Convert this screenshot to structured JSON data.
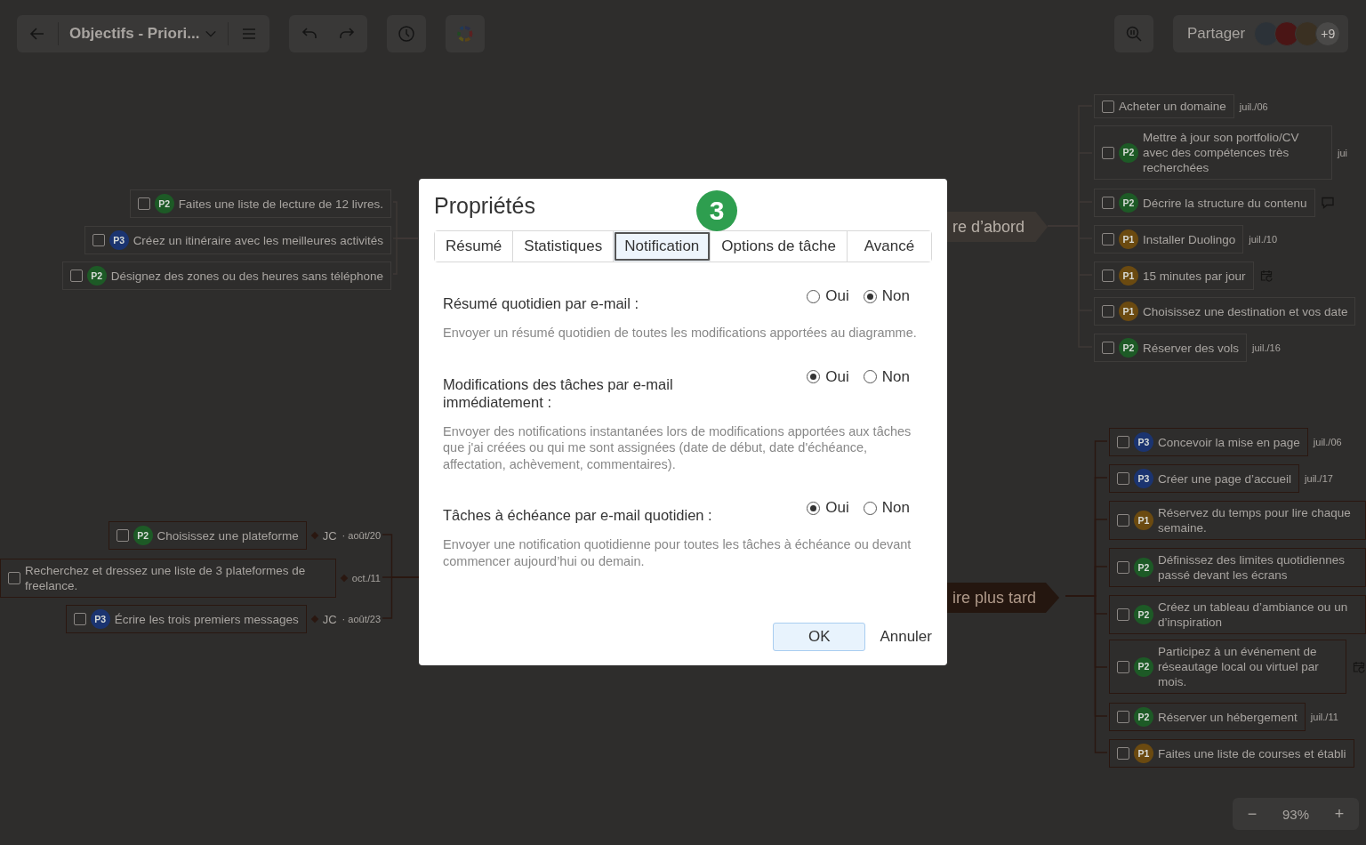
{
  "toolbar": {
    "title": "Objectifs - Priori...",
    "share_label": "Partager",
    "share_more": "+9"
  },
  "topics": [
    {
      "label": "re d’abord"
    },
    {
      "label": "ire plus tard"
    }
  ],
  "task_groups": [
    {
      "tasks": [
        {
          "text": "Faites une liste de lecture de 12 livres.",
          "priority": "P2",
          "color": "#1d5a26",
          "checked": false
        },
        {
          "text": "Créez un itinéraire avec les meilleures activités",
          "priority": "P3",
          "color": "#1b3470",
          "checked": false
        },
        {
          "text": "Désignez des zones ou des heures sans téléphone",
          "priority": "P2",
          "color": "#1d5a26",
          "checked": false
        }
      ]
    },
    {
      "tasks": [
        {
          "text": "Acheter un domaine",
          "checked": false,
          "date": "juil./06"
        },
        {
          "text": "Mettre à jour son portfolio/CV avec des compétences très recherchées",
          "priority": "P2",
          "color": "#1d5a26",
          "checked": false,
          "date": "jui"
        },
        {
          "text": "Décrire la structure du contenu",
          "priority": "P2",
          "color": "#1d5a26",
          "checked": false,
          "kind": "comment"
        },
        {
          "text": "Installer Duolingo",
          "priority": "P1",
          "color": "#6b4a10",
          "checked": false,
          "date": "juil./10"
        },
        {
          "text": "15 minutes par jour",
          "priority": "P1",
          "color": "#6b4a10",
          "checked": false,
          "kind": "recurring"
        },
        {
          "text": "Choisissez une destination et vos date",
          "priority": "P1",
          "color": "#6b4a10",
          "checked": false
        },
        {
          "text": "Réserver des vols",
          "priority": "P2",
          "color": "#1d5a26",
          "checked": false,
          "date": "juil./16"
        }
      ]
    },
    {
      "tasks": [
        {
          "text": "Choisissez une plateforme",
          "priority": "P2",
          "color": "#1d5a26",
          "checked": false,
          "assignee": "JC",
          "date": "· août/20"
        },
        {
          "text": "Recherchez et dressez une liste de 3 plateformes de freelance.",
          "checked": false,
          "date": "oct./11"
        },
        {
          "text": "Écrire les trois premiers messages",
          "priority": "P3",
          "color": "#1b3470",
          "checked": false,
          "assignee": "JC",
          "date": "· août/23"
        }
      ]
    },
    {
      "tasks": [
        {
          "text": "Concevoir la mise en page",
          "priority": "P3",
          "color": "#1b3470",
          "checked": false,
          "date": "juil./06"
        },
        {
          "text": "Créer une page d’accueil",
          "priority": "P3",
          "color": "#1b3470",
          "checked": false,
          "date": "juil./17"
        },
        {
          "text": "Réservez du temps pour lire chaque semaine.",
          "priority": "P1",
          "color": "#6b4a10",
          "checked": false
        },
        {
          "text": "Définissez des limites quotidiennes passé devant les écrans",
          "priority": "P2",
          "color": "#1d5a26",
          "checked": false
        },
        {
          "text": "Créez un tableau d’ambiance ou un d’inspiration",
          "priority": "P2",
          "color": "#1d5a26",
          "checked": false
        },
        {
          "text": "Participez à un événement de réseautage local ou virtuel par mois.",
          "priority": "P2",
          "color": "#1d5a26",
          "checked": false,
          "kind": "recurring"
        },
        {
          "text": "Réserver un hébergement",
          "priority": "P2",
          "color": "#1d5a26",
          "checked": false,
          "date": "juil./11"
        },
        {
          "text": "Faites une liste de courses et établi",
          "priority": "P1",
          "color": "#6b4a10",
          "checked": false
        }
      ]
    }
  ],
  "zoom_control": {
    "minus": "−",
    "value": "93%",
    "plus": "+"
  },
  "dialog": {
    "title": "Propriétés",
    "step": "3",
    "tabs": [
      {
        "label": "Résumé",
        "selected": false
      },
      {
        "label": "Statistiques",
        "selected": false
      },
      {
        "label": "Notification",
        "selected": true
      },
      {
        "label": "Options de tâche",
        "selected": false
      },
      {
        "label": "Avancé",
        "selected": false
      }
    ],
    "settings": [
      {
        "label": "Résumé quotidien par e-mail :",
        "options": [
          {
            "label": "Oui",
            "selected": false
          },
          {
            "label": "Non",
            "selected": true
          }
        ],
        "description": "Envoyer un résumé quotidien de toutes les modifications apportées au diagramme."
      },
      {
        "label": "Modifications des tâches par e-mail immédiatement :",
        "options": [
          {
            "label": "Oui",
            "selected": true
          },
          {
            "label": "Non",
            "selected": false
          }
        ],
        "description": "Envoyer des notifications instantanées lors de modifications apportées aux tâches que j'ai créées ou qui me sont assignées (date de début, date d'échéance, affectation, achèvement, commentaires)."
      },
      {
        "label": "Tâches à échéance par e-mail quotidien :",
        "options": [
          {
            "label": "Oui",
            "selected": true
          },
          {
            "label": "Non",
            "selected": false
          }
        ],
        "description": "Envoyer une notification quotidienne pour toutes les tâches à échéance ou devant commencer aujourd’hui ou demain."
      }
    ],
    "buttons": [
      {
        "label": "OK",
        "kind": "primary"
      },
      {
        "label": "Annuler",
        "kind": "plain"
      }
    ]
  }
}
